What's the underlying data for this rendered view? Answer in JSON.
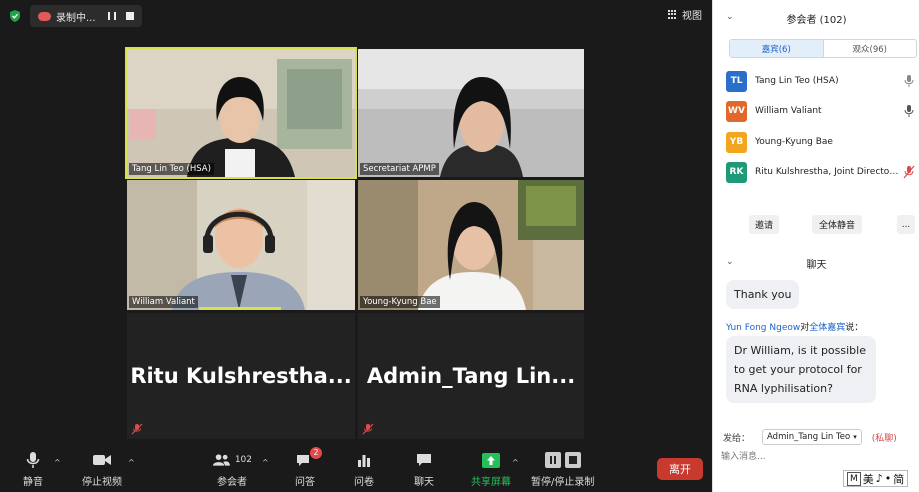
{
  "topbar": {
    "recording_label": "录制中...",
    "view_label": "视图"
  },
  "tiles": [
    {
      "name": "Tang Lin Teo (HSA)"
    },
    {
      "name": "Secretariat APMP"
    },
    {
      "name": "William Valiant"
    },
    {
      "name": "Young-Kyung Bae"
    },
    {
      "name": "Ritu  Kulshrestha..."
    },
    {
      "name": "Admin_Tang  Lin..."
    }
  ],
  "toolbar": {
    "mute": "静音",
    "stop_video": "停止视频",
    "participants": "参会者",
    "participants_count": "102",
    "qa": "问答",
    "qa_badge": "2",
    "poll": "问卷",
    "chat": "聊天",
    "share": "共享屏幕",
    "record": "暂停/停止录制",
    "leave": "离开"
  },
  "panel": {
    "participants_title": "参会者 (102)",
    "tab_panelists": "嘉宾(6)",
    "tab_attendees": "观众(96)",
    "participants": [
      {
        "initials": "TL",
        "name": "Tang Lin Teo (HSA)",
        "color": "#2a6fc9",
        "mic": "on"
      },
      {
        "initials": "WV",
        "name": "William Valiant",
        "color": "#e0682a",
        "mic": "on"
      },
      {
        "initials": "YB",
        "name": "Young-Kyung Bae",
        "color": "#f2a51e",
        "mic": "none"
      },
      {
        "initials": "RK",
        "name": "Ritu Kulshrestha, Joint Director, ...",
        "color": "#1f9a79",
        "mic": "muted"
      }
    ],
    "invite": "邀请",
    "mute_all": "全体静音",
    "more": "...",
    "chat_title": "聊天",
    "messages": [
      {
        "text": "Thank you"
      },
      {
        "sender": "Yun Fong Ngeow",
        "mid": "对",
        "target": "全体嘉宾",
        "suffix": "说：",
        "text": "Dr William, is it possible to get your protocol for RNA lyphilisation?"
      }
    ],
    "send_to_label": "发给：",
    "send_to_value": "Admin_Tang Lin Teo",
    "private_label": "(私聊)",
    "input_placeholder": "输入消息...",
    "ime": {
      "m": "M",
      "a": "美",
      "b": "♪",
      "c": "•",
      "d": "简"
    }
  }
}
